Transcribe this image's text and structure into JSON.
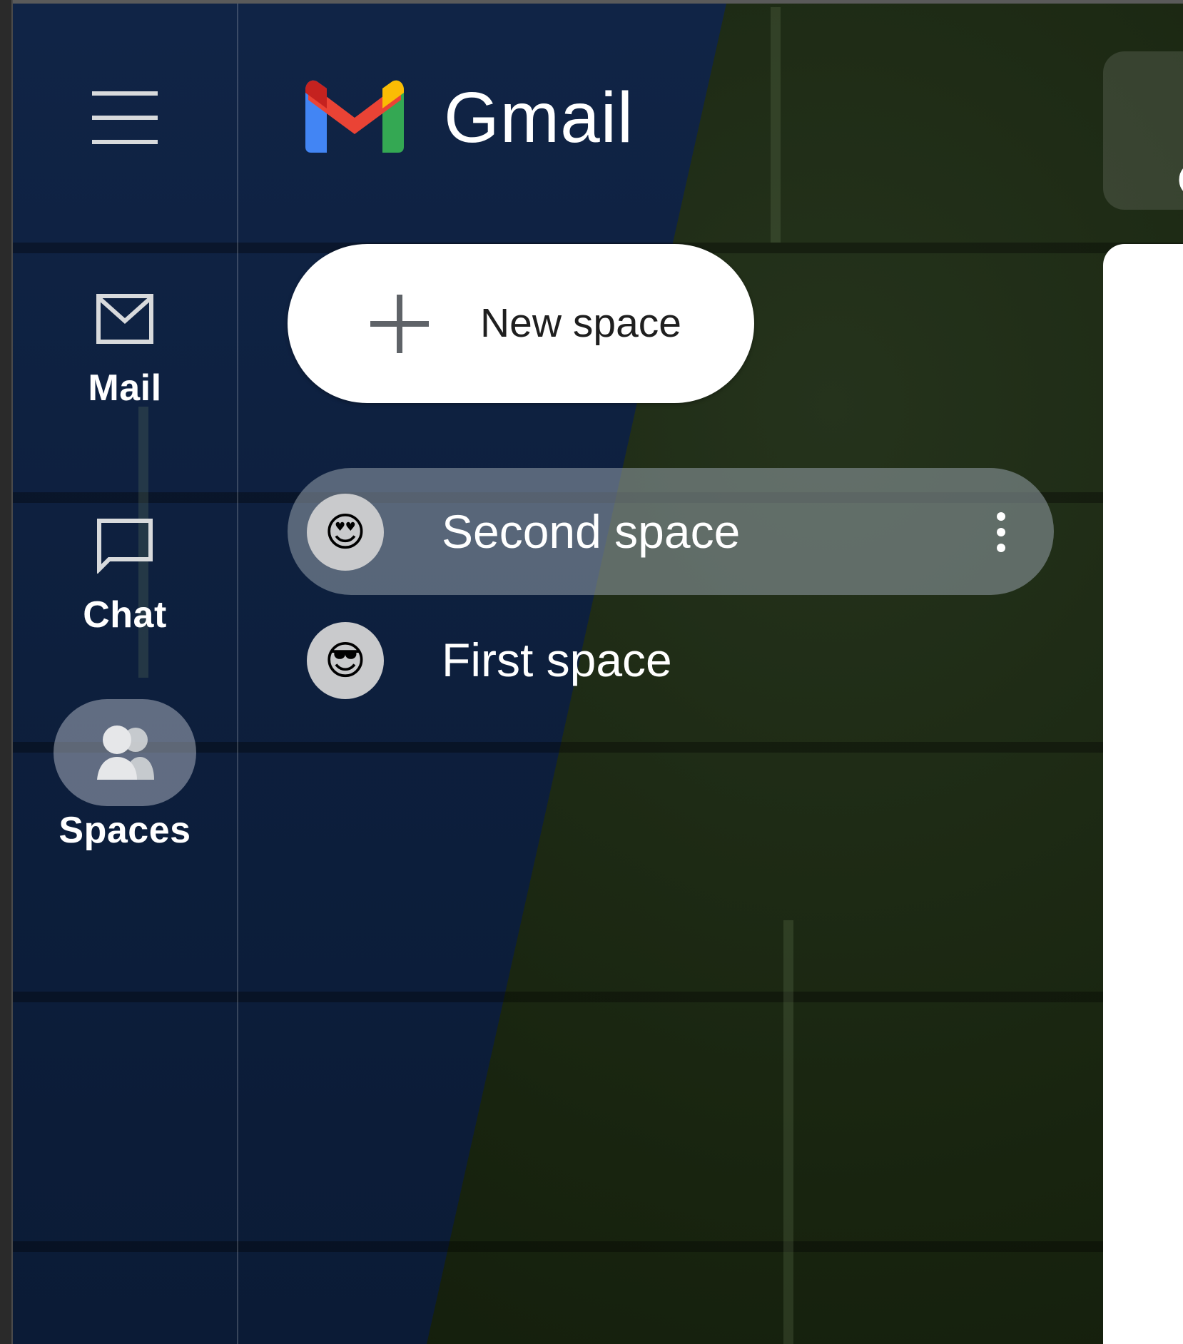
{
  "app": {
    "brand": "Gmail"
  },
  "rail": {
    "menu_icon": "hamburger-menu-icon",
    "items": [
      {
        "label": "Mail",
        "icon": "mail-envelope-icon",
        "active": false
      },
      {
        "label": "Chat",
        "icon": "chat-bubble-icon",
        "active": false
      },
      {
        "label": "Spaces",
        "icon": "spaces-people-icon",
        "active": true
      }
    ]
  },
  "new_space": {
    "label": "New space",
    "icon": "plus-icon"
  },
  "spaces": [
    {
      "name": "Second space",
      "emoji": "😍",
      "selected": true
    },
    {
      "name": "First space",
      "emoji": "😎",
      "selected": false
    }
  ],
  "colors": {
    "rail_bg": "#0d1f3d",
    "selected_item_bg": "#969faa",
    "gmail_red": "#EA4335",
    "gmail_blue": "#4285F4",
    "gmail_green": "#34A853",
    "gmail_yellow": "#FBBC04",
    "gmail_dark_red": "#C5221F"
  }
}
